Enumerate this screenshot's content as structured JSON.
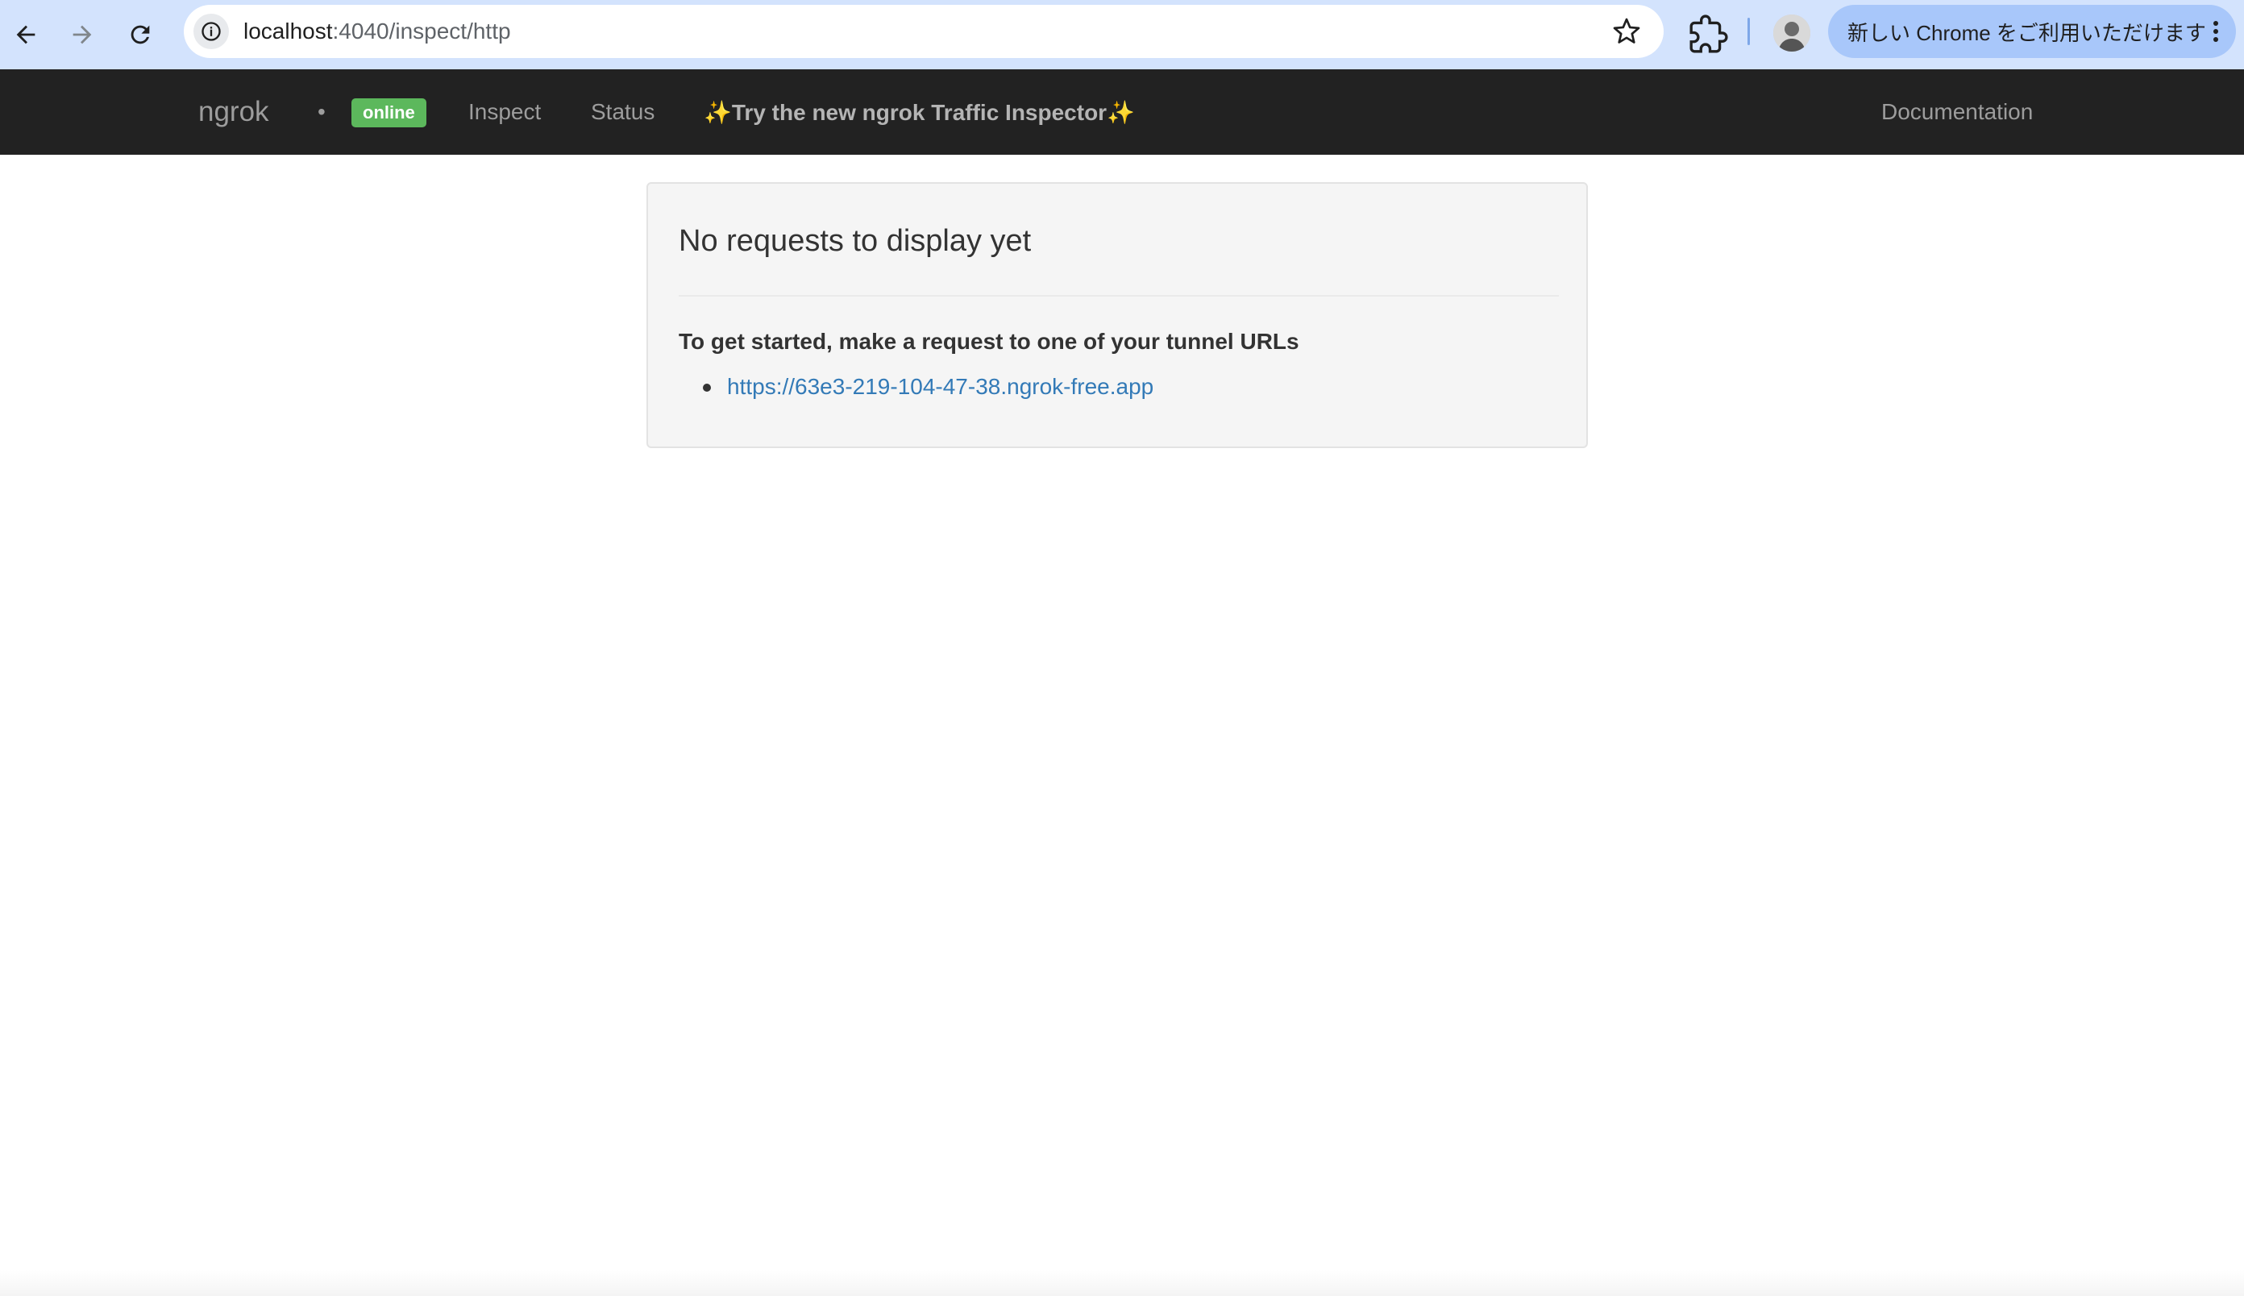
{
  "browser": {
    "url_host": "localhost",
    "url_path": ":4040/inspect/http",
    "chrome_banner": "新しい Chrome をご利用いただけます"
  },
  "navbar": {
    "brand": "ngrok",
    "separator": "•",
    "status_badge": "online",
    "links": {
      "inspect": "Inspect",
      "status": "Status",
      "promo": "✨Try the new ngrok Traffic Inspector✨",
      "documentation": "Documentation"
    }
  },
  "panel": {
    "title": "No requests to display yet",
    "subtitle": "To get started, make a request to one of your tunnel URLs",
    "tunnels": [
      "https://63e3-219-104-47-38.ngrok-free.app"
    ]
  },
  "colors": {
    "navbar_bg": "#222222",
    "badge_green": "#5cb85c",
    "link_blue": "#337ab7",
    "chrome_bar": "#d3e3fd"
  }
}
